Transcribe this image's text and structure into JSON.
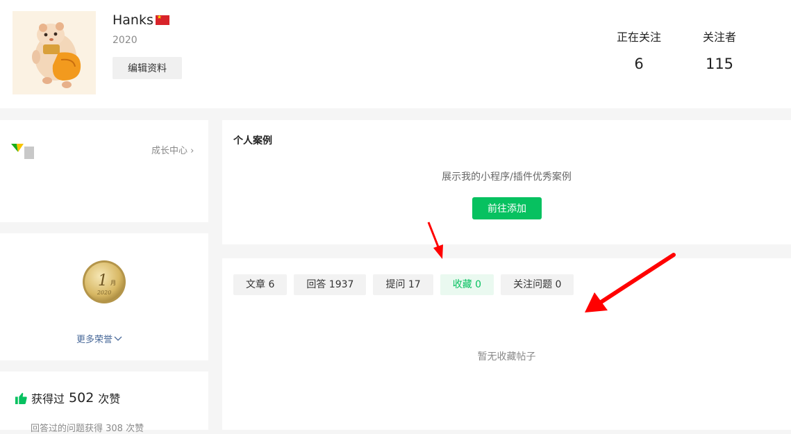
{
  "profile": {
    "username": "Hanks",
    "year": "2020",
    "edit_label": "编辑资料"
  },
  "stats": {
    "following_label": "正在关注",
    "following_value": "6",
    "followers_label": "关注者",
    "followers_value": "115"
  },
  "growth": {
    "center_label": "成长中心"
  },
  "honor": {
    "medal_month": "1",
    "medal_unit": "月",
    "medal_year": "2020",
    "more_label": "更多荣誉"
  },
  "likes": {
    "prefix": "获得过",
    "count": "502",
    "suffix": "次赞",
    "sub_text": "回答过的问题获得 308 次赞"
  },
  "cases": {
    "title": "个人案例",
    "description": "展示我的小程序/插件优秀案例",
    "add_label": "前往添加"
  },
  "tabs": [
    {
      "label": "文章 6",
      "active": false
    },
    {
      "label": "回答 1937",
      "active": false
    },
    {
      "label": "提问 17",
      "active": false
    },
    {
      "label": "收藏 0",
      "active": true
    },
    {
      "label": "关注问题 0",
      "active": false
    }
  ],
  "empty_state": "暂无收藏帖子",
  "colors": {
    "accent_green": "#07c160",
    "active_tab_bg": "#eaf9f0",
    "annotation_red": "#ff0000",
    "link_blue": "#4a6a9a"
  }
}
